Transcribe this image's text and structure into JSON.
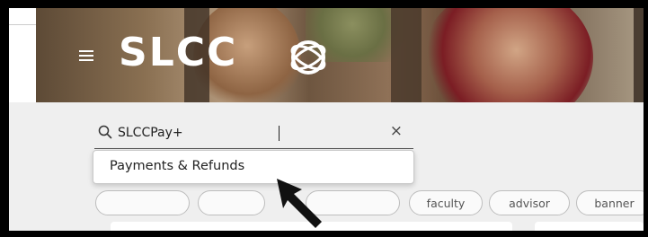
{
  "header": {
    "logo_text": "SLCC"
  },
  "search": {
    "value": "SLCCPay+",
    "clear_symbol": "×"
  },
  "suggestions": [
    {
      "label": "Payments & Refunds"
    }
  ],
  "chips": [
    {
      "label": ""
    },
    {
      "label": ""
    },
    {
      "label": ""
    },
    {
      "label": "faculty"
    },
    {
      "label": "advisor"
    },
    {
      "label": "banner"
    }
  ],
  "icons": {
    "menu": "hamburger-menu-icon",
    "search": "magnifier-icon",
    "clear": "close-icon",
    "logo_mark": "slcc-swirl-logo",
    "pointer": "black-arrow-pointer"
  },
  "colors": {
    "background": "#efefef",
    "frame": "#000000",
    "text": "#222222"
  }
}
